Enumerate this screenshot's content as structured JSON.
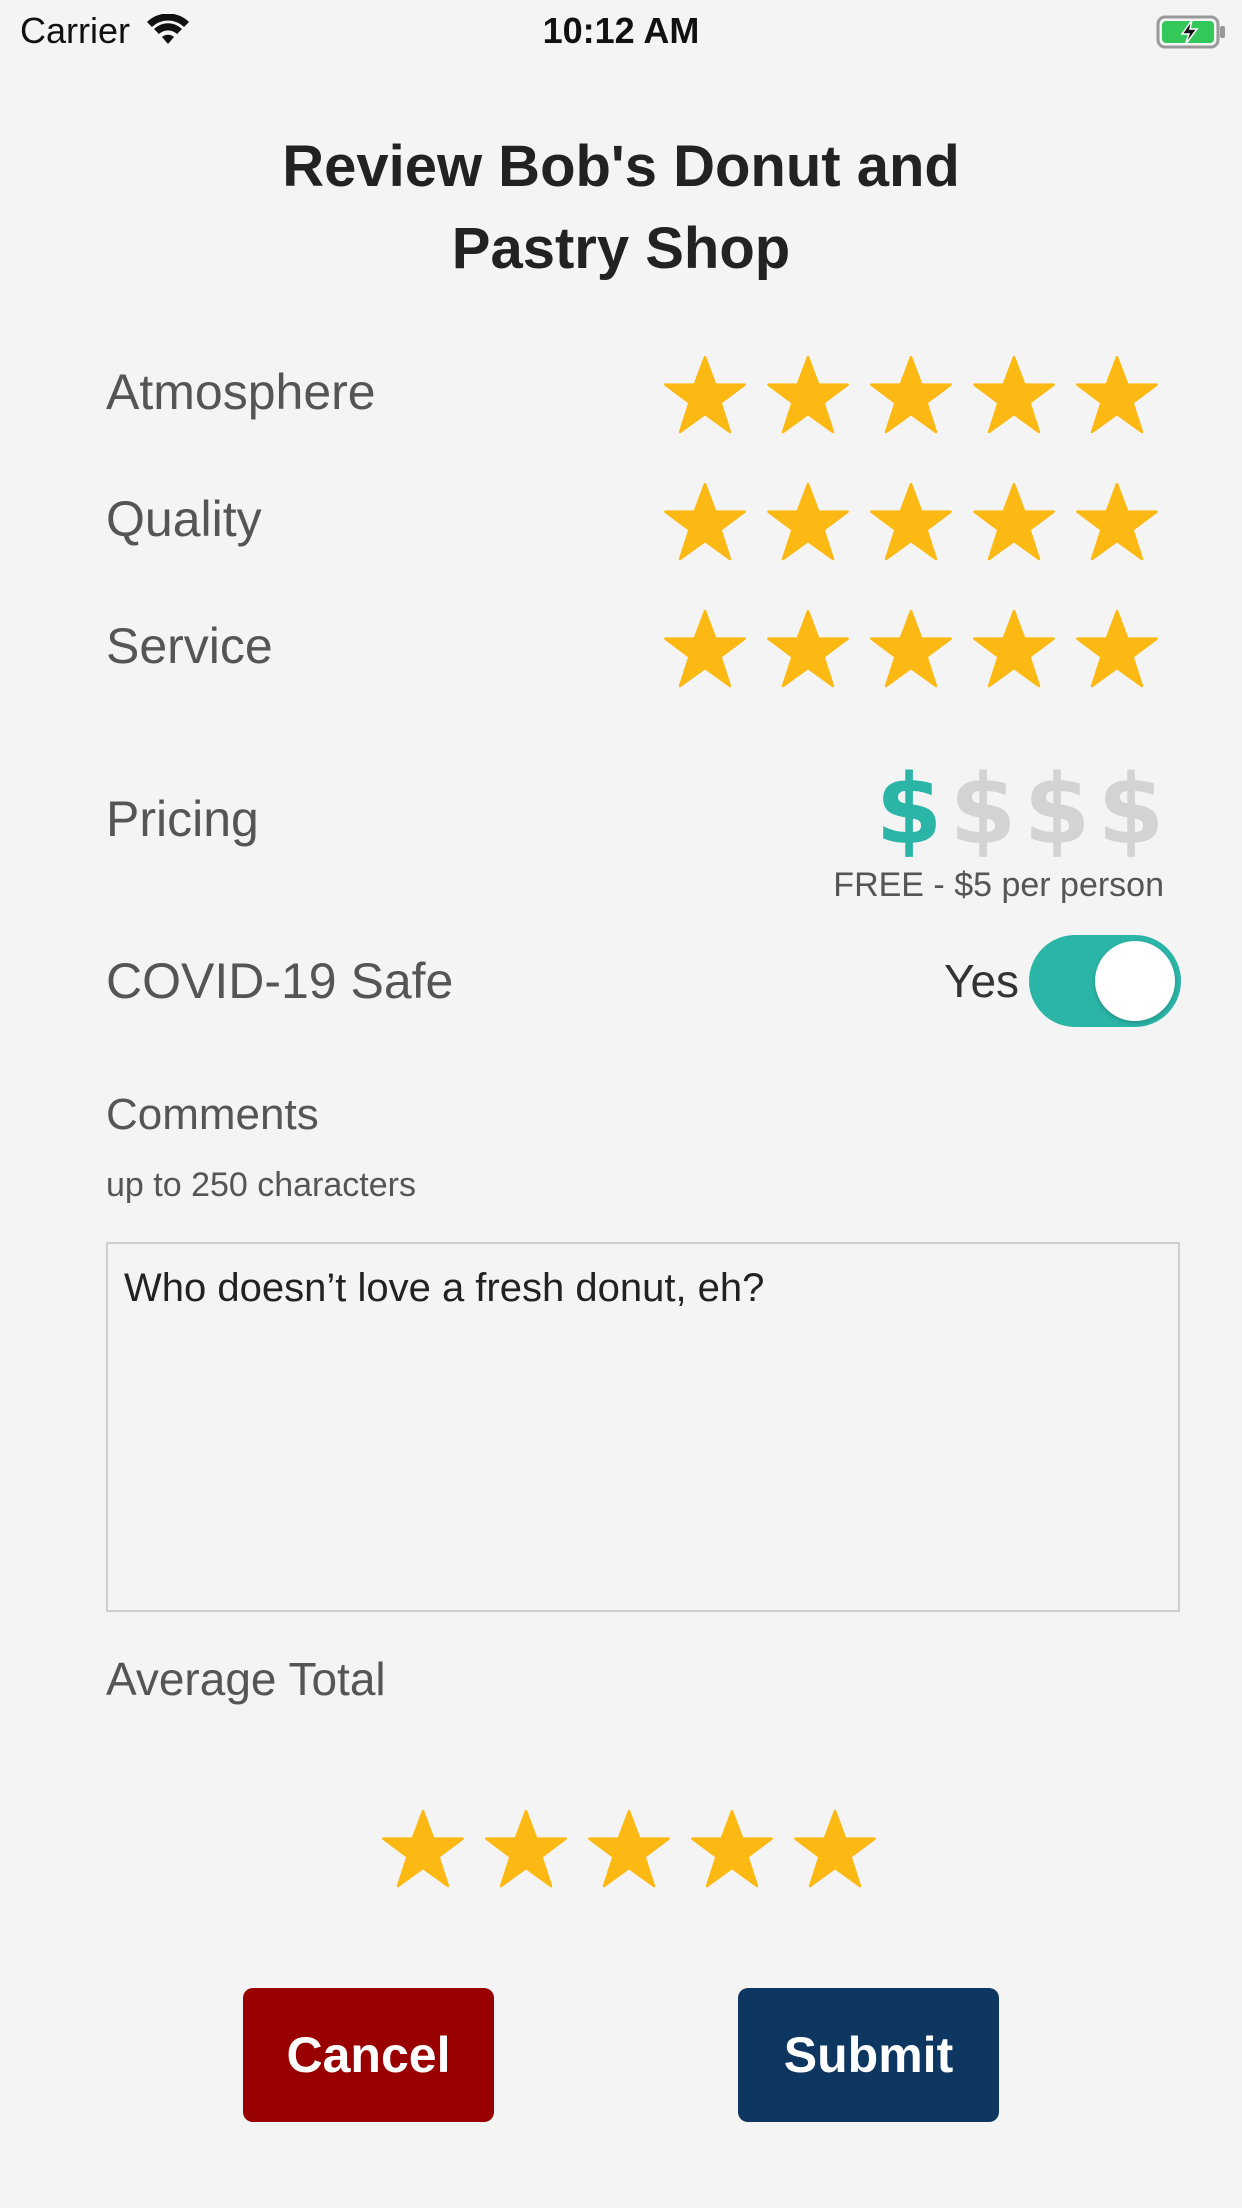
{
  "status_bar": {
    "carrier": "Carrier",
    "time": "10:12 AM"
  },
  "title": "Review Bob's Donut and Pastry Shop",
  "ratings": [
    {
      "label": "Atmosphere",
      "value": 5,
      "max": 5
    },
    {
      "label": "Quality",
      "value": 5,
      "max": 5
    },
    {
      "label": "Service",
      "value": 5,
      "max": 5
    }
  ],
  "pricing": {
    "label": "Pricing",
    "symbol": "$",
    "value": 1,
    "max": 4,
    "caption": "FREE - $5 per person"
  },
  "covid": {
    "label": "COVID-19 Safe",
    "state_text": "Yes",
    "on": true
  },
  "comments": {
    "label": "Comments",
    "hint": "up to 250 characters",
    "value": "Who doesn’t love a fresh donut, eh?"
  },
  "average": {
    "label": "Average Total",
    "value": 5,
    "max": 5
  },
  "buttons": {
    "cancel": "Cancel",
    "submit": "Submit"
  },
  "colors": {
    "star": "#FDB913",
    "accent": "#2AB5A6",
    "inactive": "#D3D3D3",
    "cancel": "#990000",
    "submit": "#0D3661"
  },
  "icons": {
    "wifi": "wifi-icon",
    "battery": "battery-charging-icon",
    "star": "star-icon"
  }
}
